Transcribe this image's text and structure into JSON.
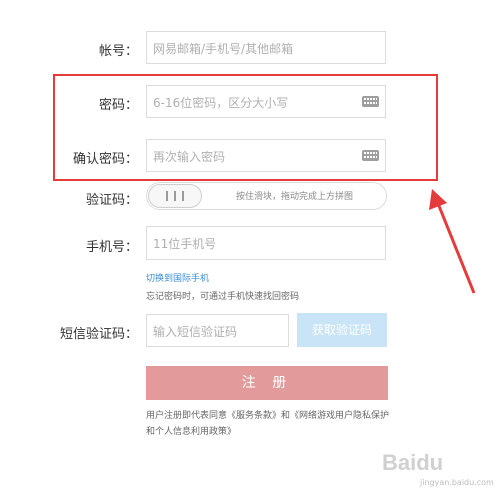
{
  "form": {
    "account": {
      "label": "帐号：",
      "placeholder": "网易邮箱/手机号/其他邮箱"
    },
    "password": {
      "label": "密码：",
      "placeholder": "6-16位密码，区分大小写",
      "icon": "keyboard-icon"
    },
    "confirm_password": {
      "label": "确认密码：",
      "placeholder": "再次输入密码",
      "icon": "keyboard-icon"
    },
    "captcha": {
      "label": "验证码：",
      "slider_text": "按住滑块，拖动完成上方拼图"
    },
    "phone": {
      "label": "手机号：",
      "placeholder": "11位手机号"
    },
    "switch_link": "切换到国际手机",
    "phone_hint": "忘记密码时，可通过手机快速找回密码",
    "sms": {
      "label": "短信验证码：",
      "placeholder": "输入短信验证码",
      "button": "获取验证码"
    },
    "register_button": "注 册",
    "agreement_text": "用户注册即代表同意《服务条款》和《网络游戏用户隐私保护和个人信息利用政策》"
  },
  "annotation": {
    "box_color": "#e43b3b",
    "arrow_color": "#e43b3b"
  },
  "watermark": {
    "brand": "Baidu",
    "sub": "jingyan.baidu.com"
  }
}
